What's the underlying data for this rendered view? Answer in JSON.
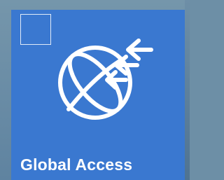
{
  "tile": {
    "label": "Global Access",
    "icon": "globe-with-inbound-arrows-icon",
    "background_color": "#3a78d0",
    "checkbox_checked": false
  }
}
